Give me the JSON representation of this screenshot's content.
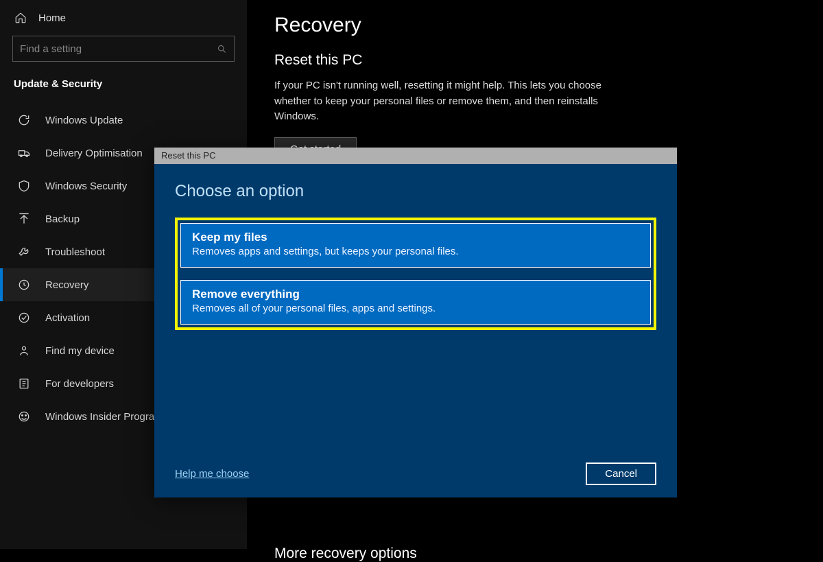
{
  "sidebar": {
    "home_label": "Home",
    "search_placeholder": "Find a setting",
    "section_title": "Update & Security",
    "items": [
      {
        "label": "Windows Update"
      },
      {
        "label": "Delivery Optimisation"
      },
      {
        "label": "Windows Security"
      },
      {
        "label": "Backup"
      },
      {
        "label": "Troubleshoot"
      },
      {
        "label": "Recovery"
      },
      {
        "label": "Activation"
      },
      {
        "label": "Find my device"
      },
      {
        "label": "For developers"
      },
      {
        "label": "Windows Insider Programme"
      }
    ]
  },
  "main": {
    "page_title": "Recovery",
    "reset_heading": "Reset this PC",
    "reset_desc": "If your PC isn't running well, resetting it might help. This lets you choose whether to keep your personal files or remove them, and then reinstalls Windows.",
    "get_started_label": "Get started",
    "more_heading": "More recovery options"
  },
  "dialog": {
    "titlebar": "Reset this PC",
    "heading": "Choose an option",
    "options": [
      {
        "title": "Keep my files",
        "desc": "Removes apps and settings, but keeps your personal files."
      },
      {
        "title": "Remove everything",
        "desc": "Removes all of your personal files, apps and settings."
      }
    ],
    "help_link": "Help me choose",
    "cancel_label": "Cancel"
  }
}
